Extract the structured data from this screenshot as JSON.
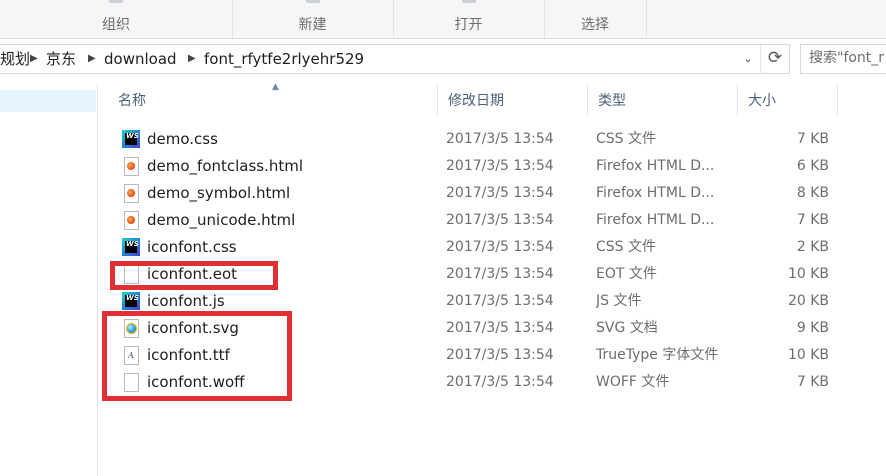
{
  "ribbon": {
    "groups": [
      {
        "label": "组织"
      },
      {
        "label": "新建"
      },
      {
        "label": "打开"
      },
      {
        "label": "选择"
      }
    ]
  },
  "address": {
    "crumbs": [
      "规划",
      "京东",
      "download",
      "font_rfytfe2rlyehr529"
    ]
  },
  "search": {
    "placeholder": "搜索\"font_r"
  },
  "columns": {
    "name": "名称",
    "date": "修改日期",
    "type": "类型",
    "size": "大小"
  },
  "files": [
    {
      "name": "demo.css",
      "date": "2017/3/5 13:54",
      "type": "CSS 文件",
      "size": "7 KB",
      "icon": "webstorm-icon"
    },
    {
      "name": "demo_fontclass.html",
      "date": "2017/3/5 13:54",
      "type": "Firefox HTML D...",
      "size": "6 KB",
      "icon": "firefox-html-icon"
    },
    {
      "name": "demo_symbol.html",
      "date": "2017/3/5 13:54",
      "type": "Firefox HTML D...",
      "size": "8 KB",
      "icon": "firefox-html-icon"
    },
    {
      "name": "demo_unicode.html",
      "date": "2017/3/5 13:54",
      "type": "Firefox HTML D...",
      "size": "7 KB",
      "icon": "firefox-html-icon"
    },
    {
      "name": "iconfont.css",
      "date": "2017/3/5 13:54",
      "type": "CSS 文件",
      "size": "2 KB",
      "icon": "webstorm-icon"
    },
    {
      "name": "iconfont.eot",
      "date": "2017/3/5 13:54",
      "type": "EOT 文件",
      "size": "10 KB",
      "icon": "blank-file-icon"
    },
    {
      "name": "iconfont.js",
      "date": "2017/3/5 13:54",
      "type": "JS 文件",
      "size": "20 KB",
      "icon": "webstorm-icon"
    },
    {
      "name": "iconfont.svg",
      "date": "2017/3/5 13:54",
      "type": "SVG 文档",
      "size": "9 KB",
      "icon": "ie-svg-icon"
    },
    {
      "name": "iconfont.ttf",
      "date": "2017/3/5 13:54",
      "type": "TrueType 字体文件",
      "size": "10 KB",
      "icon": "truetype-font-icon"
    },
    {
      "name": "iconfont.woff",
      "date": "2017/3/5 13:54",
      "type": "WOFF 文件",
      "size": "7 KB",
      "icon": "blank-file-icon"
    }
  ],
  "colors": {
    "highlight_border": "#e03034",
    "header_text": "#4c607a"
  }
}
